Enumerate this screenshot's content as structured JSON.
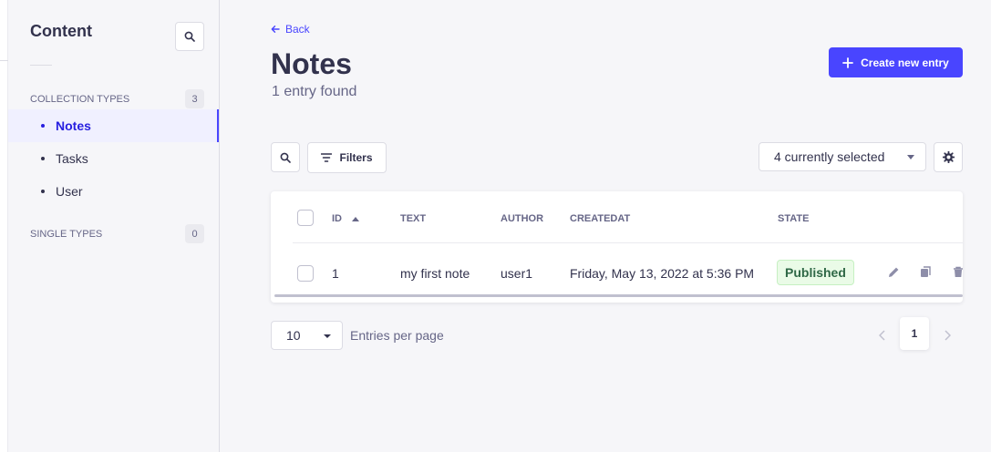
{
  "sidebar": {
    "title": "Content",
    "sections": [
      {
        "label": "COLLECTION TYPES",
        "count": "3",
        "items": [
          {
            "label": "Notes",
            "active": true
          },
          {
            "label": "Tasks",
            "active": false
          },
          {
            "label": "User",
            "active": false
          }
        ]
      },
      {
        "label": "SINGLE TYPES",
        "count": "0",
        "items": []
      }
    ]
  },
  "header": {
    "back_label": "Back",
    "title": "Notes",
    "subtitle": "1 entry found",
    "create_label": "Create new entry"
  },
  "toolbar": {
    "filters_label": "Filters",
    "columns_select_value": "4 currently selected"
  },
  "table": {
    "columns": [
      "ID",
      "TEXT",
      "AUTHOR",
      "CREATEDAT",
      "STATE"
    ],
    "rows": [
      {
        "id": "1",
        "text": "my first note",
        "author": "user1",
        "createdat": "Friday, May 13, 2022 at 5:36 PM",
        "state": "Published"
      }
    ]
  },
  "pagination": {
    "page_size": "10",
    "page_size_label": "Entries per page",
    "current_page": "1"
  },
  "colors": {
    "primary": "#4945ff",
    "published_bg": "#eafbe7",
    "published_text": "#2f6846"
  }
}
